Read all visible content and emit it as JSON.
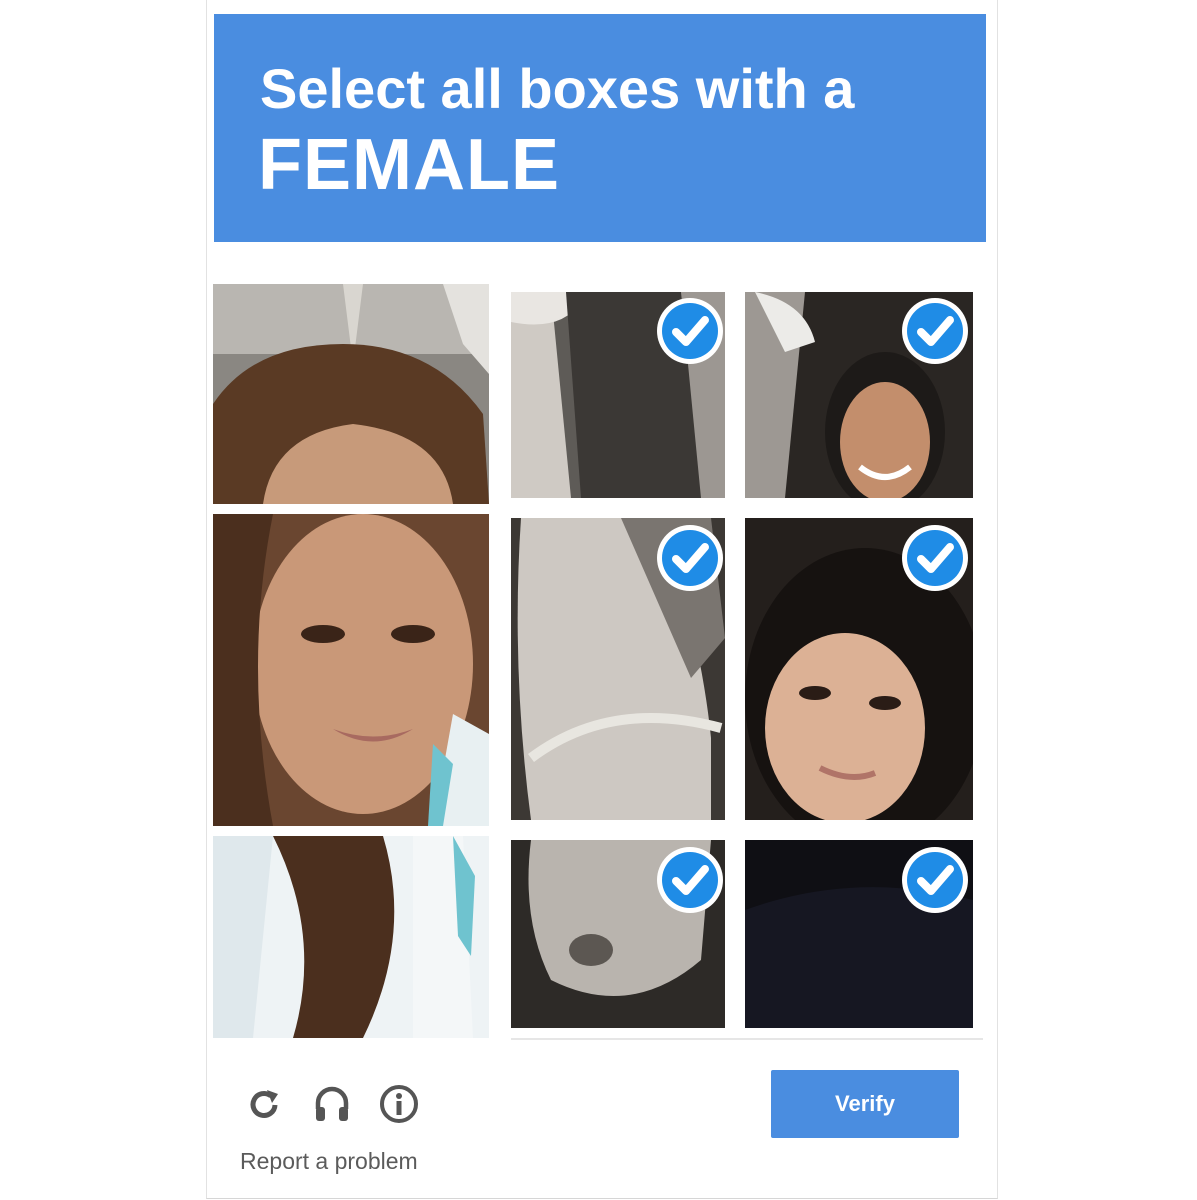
{
  "header": {
    "line1": "Select all boxes with a",
    "line2": "FEMALE"
  },
  "tiles": [
    {
      "id": "woman-left-top",
      "selected": false
    },
    {
      "id": "woman-left-middle",
      "selected": false
    },
    {
      "id": "woman-left-bottom",
      "selected": false
    },
    {
      "id": "horse-top",
      "selected": true
    },
    {
      "id": "woman-top-right",
      "selected": true
    },
    {
      "id": "horse-middle",
      "selected": true
    },
    {
      "id": "woman-middle-right",
      "selected": true
    },
    {
      "id": "horse-bottom",
      "selected": true
    },
    {
      "id": "dark-bottom-right",
      "selected": true
    }
  ],
  "footer": {
    "icons": [
      "reload-icon",
      "headphones-icon",
      "info-icon"
    ],
    "report_label": "Report a problem",
    "verify_label": "Verify"
  },
  "colors": {
    "accent": "#4a8de0",
    "check": "#1f8ce6"
  }
}
